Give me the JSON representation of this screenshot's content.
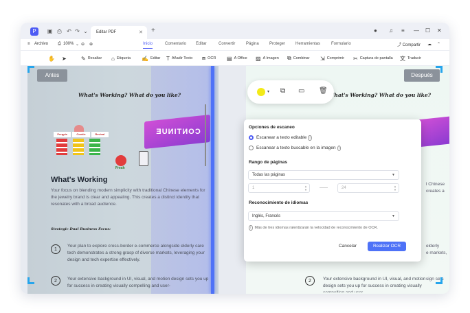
{
  "window": {
    "tab_title": "Editar PDF",
    "zoom": "100%"
  },
  "menu": {
    "file": "Archivo",
    "tabs": [
      "Inicio",
      "Comentario",
      "Editar",
      "Convertir",
      "Página",
      "Proteger",
      "Herramientas",
      "Formulario"
    ],
    "active_tab": "Inicio",
    "share": "Compartir"
  },
  "toolbar": {
    "tools": [
      "Resaltar",
      "Etiqueta",
      "Editar",
      "Añadir Texto",
      "OCR",
      "A Office",
      "A Imagen",
      "Combinar",
      "Comprimir",
      "Captura de pantalla",
      "Traducir"
    ]
  },
  "document": {
    "before_label": "Antes",
    "after_label": "Después",
    "handwritten_title": "What's Working? What do you like?",
    "signs": [
      "Preppie",
      "Cookie",
      "Revival"
    ],
    "sticker": "Fresh",
    "banner": "CONTINUE",
    "section_title": "What's Working",
    "section_text": "Your focus on blending modern simplicity with traditional Chinese elements for the jewelry brand is clear and appealing. This creates a distinct identity that resonates with a broad audience.",
    "strategy_label": "Strategic Dual Business Focus:",
    "item1_text": "Your plan to explore cross-border e-commerce alongside elderly care tech demonstrates a strong grasp of diverse markets, leveraging your design and tech expertise effectively.",
    "item2_text": "Your extensive background in UI, visual, and motion design sets you up for success in creating visually compelling and user-",
    "right_fragments": [
      "l Chinese",
      "creates a",
      "elderly",
      "e markets,",
      "sign sets"
    ]
  },
  "ocr_dialog": {
    "scan_options_label": "Opciones de escaneo",
    "option_editable": "Escanear a texto editable",
    "option_searchable": "Escanear a texto buscable en la imagen",
    "page_range_label": "Rango de páginas",
    "page_range_value": "Todas las páginas",
    "from_page": "1",
    "to_page": "24",
    "language_label": "Reconocimiento de idiomas",
    "language_value": "Inglés, Francés",
    "note": "Más de tres idiomas ralentizarán la velocidad de reconocimiento de OCR.",
    "cancel": "Cancelar",
    "perform": "Realizar OCR"
  },
  "colors": {
    "accent": "#4e5cf4",
    "scan_bar": "#4e72f7",
    "highlight_swatch": "#f3ea18",
    "corner_marks": "#26a5ec"
  }
}
